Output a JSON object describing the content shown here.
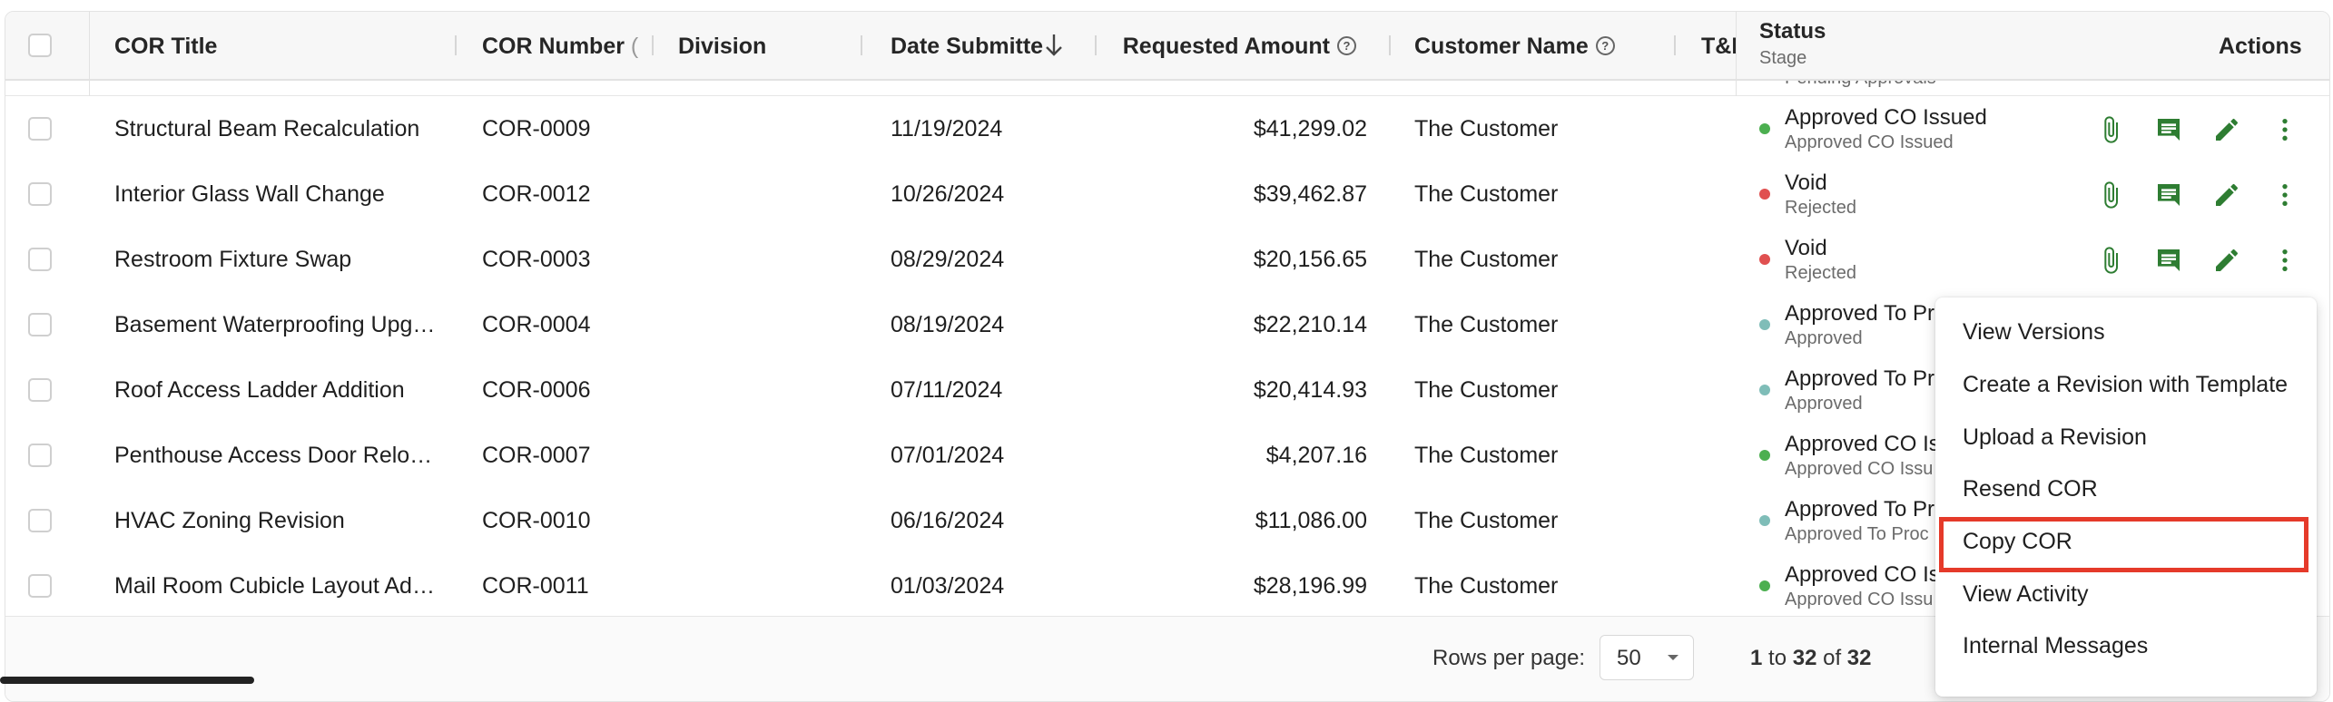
{
  "header": {
    "columns": {
      "title": "COR Title",
      "number": "COR Number",
      "number_icon": "(",
      "division": "Division",
      "date": "Date Submitte",
      "amount": "Requested Amount",
      "customer": "Customer Name",
      "tm": "T&I",
      "status": "Status",
      "stage": "Stage",
      "actions": "Actions"
    },
    "partial_stage_text": "Pending Approvals"
  },
  "rows": [
    {
      "title": "Structural Beam Recalculation",
      "number": "COR-0009",
      "date": "11/19/2024",
      "amount": "$41,299.02",
      "customer": "The Customer",
      "status": "Approved CO Issued",
      "stage": "Approved CO Issued",
      "dot": "#4caf50"
    },
    {
      "title": "Interior Glass Wall Change",
      "number": "COR-0012",
      "date": "10/26/2024",
      "amount": "$39,462.87",
      "customer": "The Customer",
      "status": "Void",
      "stage": "Rejected",
      "dot": "#e05050"
    },
    {
      "title": "Restroom Fixture Swap",
      "number": "COR-0003",
      "date": "08/29/2024",
      "amount": "$20,156.65",
      "customer": "The Customer",
      "status": "Void",
      "stage": "Rejected",
      "dot": "#e05050"
    },
    {
      "title": "Basement Waterproofing Upg…",
      "number": "COR-0004",
      "date": "08/19/2024",
      "amount": "$22,210.14",
      "customer": "The Customer",
      "status": "Approved To Pr",
      "stage": "Approved",
      "dot": "#7fbdb8"
    },
    {
      "title": "Roof Access Ladder Addition",
      "number": "COR-0006",
      "date": "07/11/2024",
      "amount": "$20,414.93",
      "customer": "The Customer",
      "status": "Approved To Pr",
      "stage": "Approved",
      "dot": "#7fbdb8"
    },
    {
      "title": "Penthouse Access Door Relo…",
      "number": "COR-0007",
      "date": "07/01/2024",
      "amount": "$4,207.16",
      "customer": "The Customer",
      "status": "Approved CO Is",
      "stage": "Approved CO Issu",
      "dot": "#4caf50"
    },
    {
      "title": "HVAC Zoning Revision",
      "number": "COR-0010",
      "date": "06/16/2024",
      "amount": "$11,086.00",
      "customer": "The Customer",
      "status": "Approved To Pr",
      "stage": "Approved To Proc",
      "dot": "#7fbdb8"
    },
    {
      "title": "Mail Room Cubicle Layout Ad…",
      "number": "COR-0011",
      "date": "01/03/2024",
      "amount": "$28,196.99",
      "customer": "The Customer",
      "status": "Approved CO Is",
      "stage": "Approved CO Issu",
      "dot": "#4caf50"
    }
  ],
  "footer": {
    "rows_per_page_label": "Rows per page:",
    "rows_per_page_value": "50",
    "range_start": "1",
    "range_to": "to",
    "range_end": "32",
    "range_of": "of",
    "total": "32"
  },
  "menu": {
    "items": [
      "View Versions",
      "Create a Revision with Template",
      "Upload a Revision",
      "Resend COR",
      "Copy COR",
      "View Activity",
      "Internal Messages"
    ],
    "highlighted": "Copy COR"
  },
  "colors": {
    "action_green": "#2e7d32",
    "highlight_red": "#e53a2a"
  }
}
